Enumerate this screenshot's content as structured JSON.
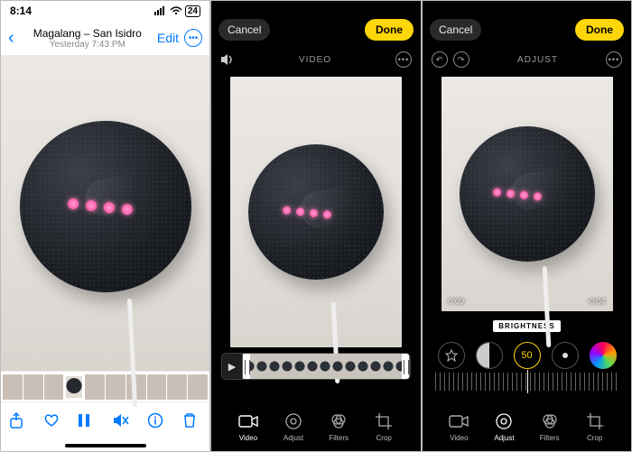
{
  "viewer": {
    "status_time": "8:14",
    "battery_pct": "24",
    "location": "Magalang – San Isidro",
    "timestamp": "Yesterday  7:43 PM",
    "edit_label": "Edit",
    "toolbar": {
      "share": "Share",
      "favorite": "Favorite",
      "pause": "Pause",
      "mute": "Mute",
      "info": "Info",
      "trash": "Delete"
    }
  },
  "edit": {
    "cancel_label": "Cancel",
    "done_label": "Done",
    "mode_video_label": "VIDEO",
    "mode_adjust_label": "ADJUST",
    "tabs": {
      "video": "Video",
      "adjust": "Adjust",
      "filters": "Filters",
      "crop": "Crop"
    }
  },
  "adjust": {
    "time_elapsed": "0:09",
    "time_remaining": "-0:04",
    "current_tool": "BRIGHTNESS",
    "current_value": "50",
    "tools": [
      "Auto",
      "Exposure",
      "Brightness",
      "Highlights",
      "Color"
    ]
  },
  "colors": {
    "ios_blue": "#007aff",
    "ios_yellow": "#ffd60a"
  }
}
